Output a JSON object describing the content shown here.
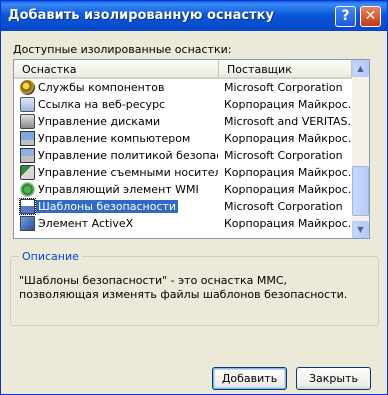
{
  "window": {
    "title": "Добавить изолированную оснастку",
    "help_label": "?",
    "close_label": "✕"
  },
  "available_label": "Доступные изолированные оснастки:",
  "columns": [
    "Оснастка",
    "Поставщик"
  ],
  "snapins": [
    {
      "name": "Службы компонентов",
      "vendor": "Microsoft Corporation",
      "icon": "component-services-icon"
    },
    {
      "name": "Ссылка на веб-ресурс",
      "vendor": "Корпорация Майкрос...",
      "icon": "web-link-icon"
    },
    {
      "name": "Управление дисками",
      "vendor": "Microsoft and VERITAS...",
      "icon": "disk-management-icon"
    },
    {
      "name": "Управление компьютером",
      "vendor": "Корпорация Майкрос...",
      "icon": "computer-management-icon"
    },
    {
      "name": "Управление политикой безопас...",
      "vendor": "Microsoft Corporation",
      "icon": "security-policy-icon"
    },
    {
      "name": "Управление съемными носител...",
      "vendor": "Корпорация Майкрос...",
      "icon": "removable-storage-icon"
    },
    {
      "name": "Управляющий элемент WMI",
      "vendor": "Корпорация Майкрос...",
      "icon": "wmi-control-icon"
    },
    {
      "name": "Шаблоны безопасности",
      "vendor": "Microsoft Corporation",
      "icon": "security-templates-icon",
      "selected": true
    },
    {
      "name": "Элемент ActiveX",
      "vendor": "Корпорация Майкрос...",
      "icon": "activex-control-icon"
    }
  ],
  "description": {
    "title": "Описание",
    "text": "\"Шаблоны безопасности\" - это оснастка MMC, позволяющая изменять файлы шаблонов безопасности."
  },
  "buttons": {
    "add": "Добавить",
    "close": "Закрыть"
  },
  "scrollbar": {
    "up": "▲",
    "down": "▼"
  }
}
